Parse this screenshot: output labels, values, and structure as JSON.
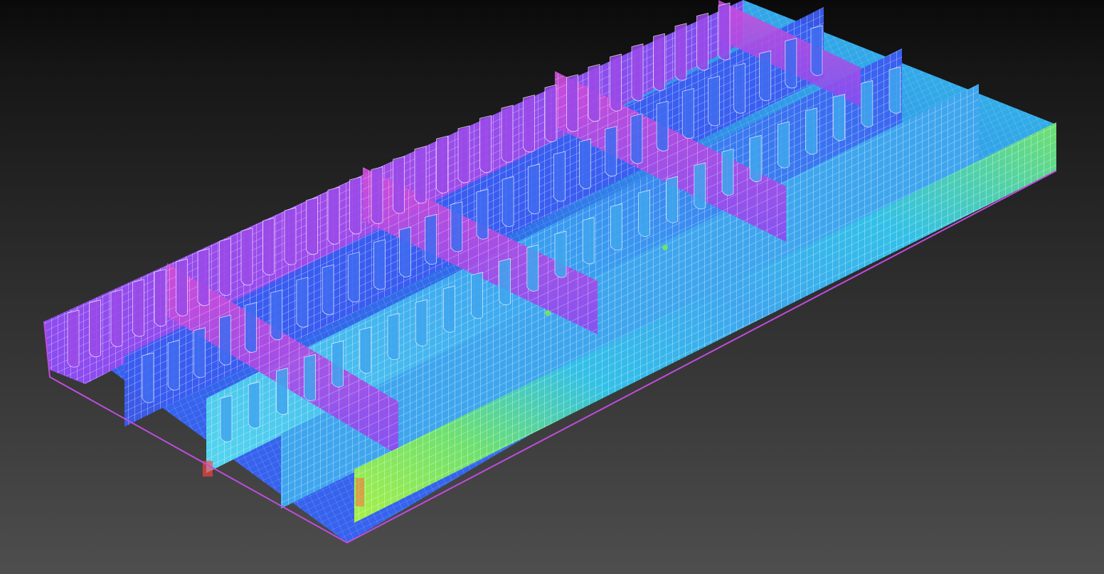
{
  "viewport": {
    "background_top": "#0a0a0a",
    "background_bottom": "#4e4e4e"
  },
  "model": {
    "kind": "fe-mesh-ship-hull-block",
    "view": "isometric",
    "colors": {
      "magenta": "#c04ce0",
      "violet": "#8a4cf0",
      "blue": "#3a5cf0",
      "deep_blue": "#2a3ccc",
      "cyan": "#33c0e8",
      "light_cyan": "#55d6ee",
      "green": "#6ee070",
      "lime": "#a8f048",
      "teal": "#1a8c86",
      "mesh_line": "#ffffff",
      "hot": "#ff4040"
    }
  }
}
